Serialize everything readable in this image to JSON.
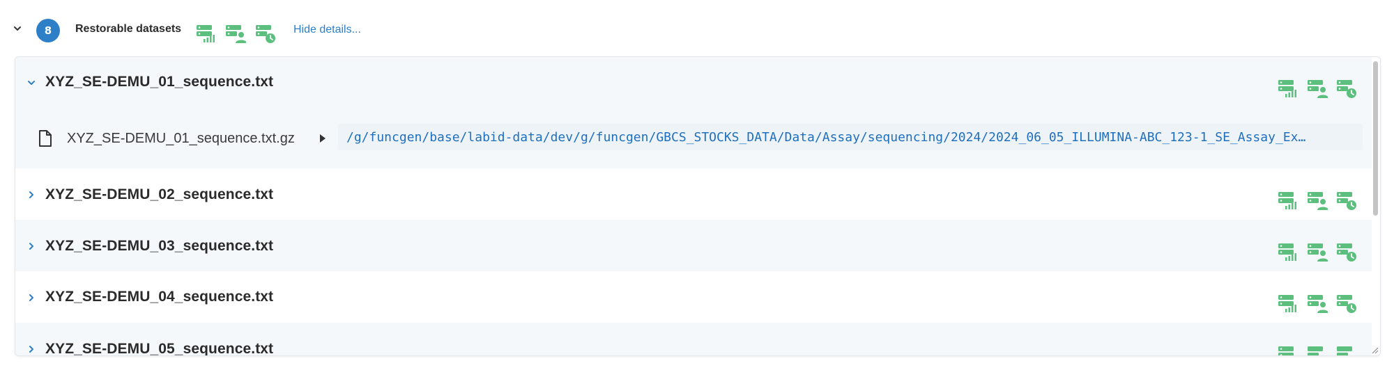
{
  "header": {
    "count": "8",
    "title": "Restorable datasets",
    "hide_link": "Hide details...",
    "icons": [
      "storage-signal-icon",
      "storage-user-icon",
      "storage-clock-icon"
    ]
  },
  "colors": {
    "accent": "#2d7fc8",
    "icon_green": "#5cbf7e",
    "row_alt": "#f5f8fb",
    "path_bg": "#eef3f8"
  },
  "datasets": [
    {
      "name": "XYZ_SE-DEMU_01_sequence.txt",
      "expanded": true,
      "file": {
        "name": "XYZ_SE-DEMU_01_sequence.txt.gz",
        "path": "/g/funcgen/base/labid-data/dev/g/funcgen/GBCS_STOCKS_DATA/Data/Assay/sequencing/2024/2024_06_05_ILLUMINA-ABC_123-1_SE_Assay_Ex…"
      }
    },
    {
      "name": "XYZ_SE-DEMU_02_sequence.txt",
      "expanded": false
    },
    {
      "name": "XYZ_SE-DEMU_03_sequence.txt",
      "expanded": false
    },
    {
      "name": "XYZ_SE-DEMU_04_sequence.txt",
      "expanded": false
    },
    {
      "name": "XYZ_SE-DEMU_05_sequence.txt",
      "expanded": false
    }
  ]
}
